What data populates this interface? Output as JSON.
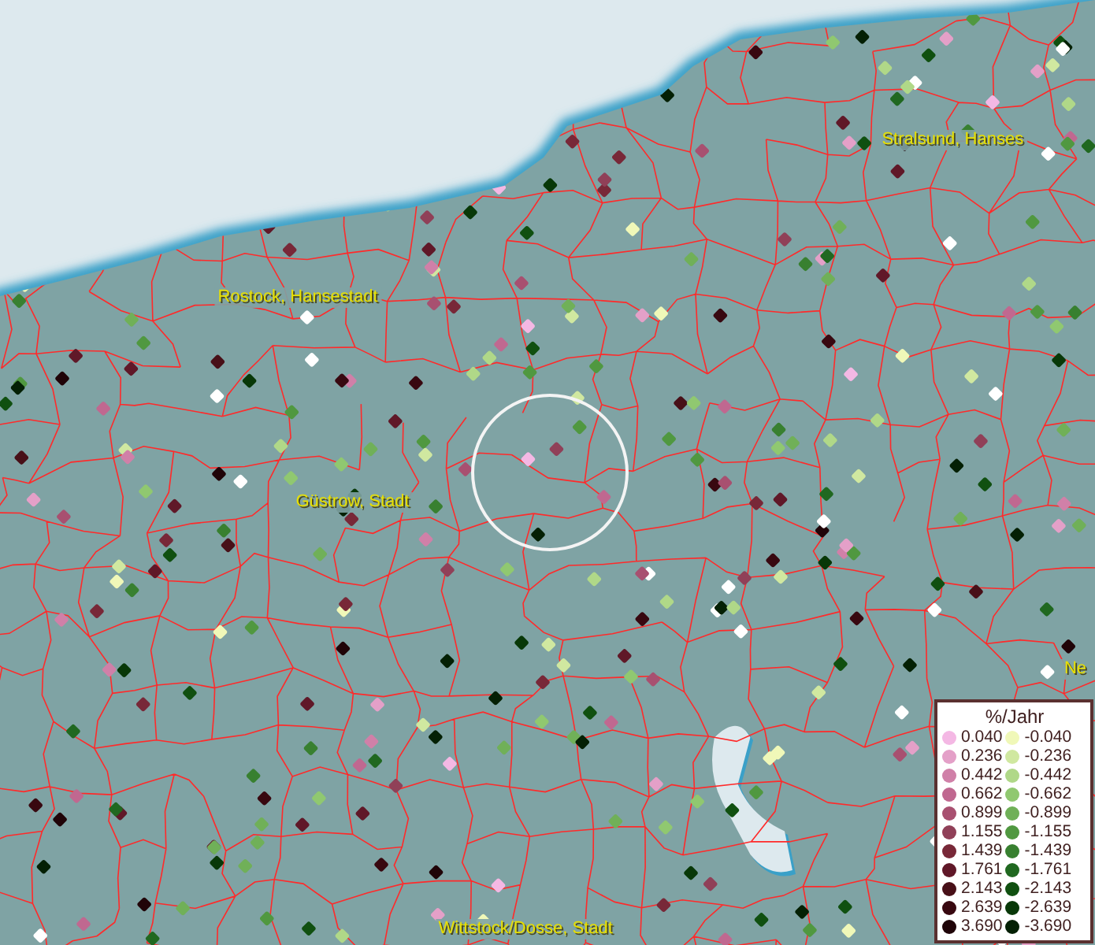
{
  "map": {
    "labels": [
      {
        "text": "Stralsund, Hanses"
      },
      {
        "text": "Rostock, Hansestadt"
      },
      {
        "text": "Güstrow, Stadt"
      },
      {
        "text": "Ne"
      },
      {
        "text": "Wittstock/Dosse, Stadt"
      }
    ]
  },
  "legend": {
    "title": "%/Jahr",
    "positive": [
      {
        "label": "0.040",
        "color": "#f4b8e4"
      },
      {
        "label": "0.236",
        "color": "#e4a0c8"
      },
      {
        "label": "0.442",
        "color": "#d080a8"
      },
      {
        "label": "0.662",
        "color": "#c06890"
      },
      {
        "label": "0.899",
        "color": "#a85070"
      },
      {
        "label": "1.155",
        "color": "#904058"
      },
      {
        "label": "1.439",
        "color": "#782838"
      },
      {
        "label": "1.761",
        "color": "#601828"
      },
      {
        "label": "2.143",
        "color": "#481018"
      },
      {
        "label": "2.639",
        "color": "#380810"
      },
      {
        "label": "3.690",
        "color": "#200408"
      }
    ],
    "negative": [
      {
        "label": "-0.040",
        "color": "#f0f8b8"
      },
      {
        "label": "-0.236",
        "color": "#d0e8a0"
      },
      {
        "label": "-0.442",
        "color": "#b0d888"
      },
      {
        "label": "-0.662",
        "color": "#90c870"
      },
      {
        "label": "-0.899",
        "color": "#70b058"
      },
      {
        "label": "-1.155",
        "color": "#509840"
      },
      {
        "label": "-1.439",
        "color": "#388030"
      },
      {
        "label": "-1.761",
        "color": "#206820"
      },
      {
        "label": "-2.143",
        "color": "#105010"
      },
      {
        "label": "-2.639",
        "color": "#083808"
      },
      {
        "label": "-3.690",
        "color": "#042004"
      }
    ]
  }
}
